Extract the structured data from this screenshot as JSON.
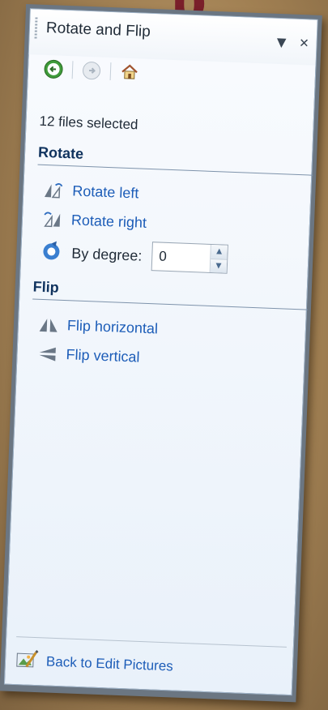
{
  "backdrop": {
    "fragment": "p"
  },
  "pane": {
    "title": "Rotate and Flip",
    "files_selected": "12 files selected"
  },
  "rotate": {
    "heading": "Rotate",
    "rotate_left": "Rotate left",
    "rotate_right": "Rotate right",
    "by_degree_label": "By degree:",
    "degree_value": "0"
  },
  "flip": {
    "heading": "Flip",
    "flip_horizontal": "Flip horizontal",
    "flip_vertical": "Flip vertical"
  },
  "footer": {
    "back_label": "Back to Edit Pictures"
  },
  "icons": {
    "back": "back-arrow-icon",
    "forward": "forward-arrow-icon",
    "home": "home-icon",
    "dropdown": "chevron-down-icon",
    "close": "close-icon"
  },
  "colors": {
    "link": "#1d5db8",
    "heading": "#10335e",
    "pane_bg": "#eef4fb"
  }
}
